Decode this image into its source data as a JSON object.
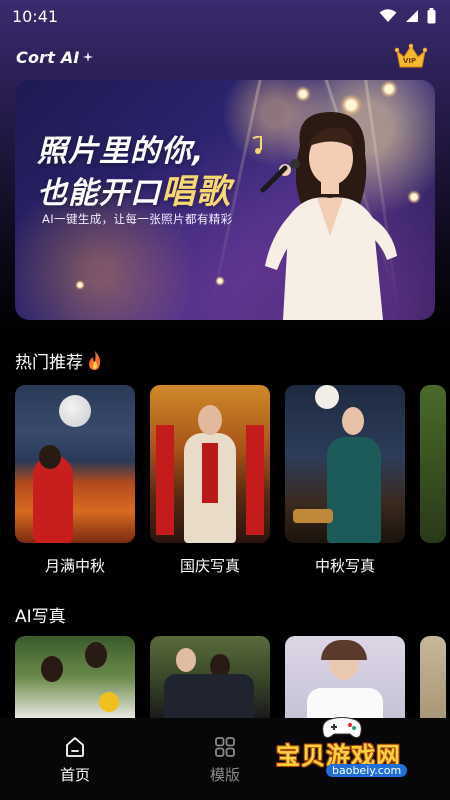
{
  "status_bar": {
    "time": "10:41"
  },
  "header": {
    "logo": "Cort AI",
    "vip_badge": "VIP"
  },
  "banner": {
    "title_line1": "照片里的你,",
    "title_line2_prefix": "也能开口",
    "title_line2_highlight": "唱歌",
    "subtitle": "AI一键生成，让每一张照片都有精彩"
  },
  "hot": {
    "title": "热门推荐",
    "items": [
      {
        "label": "月满中秋"
      },
      {
        "label": "国庆写真"
      },
      {
        "label": "中秋写真"
      }
    ]
  },
  "ai_photo": {
    "title": "AI写真"
  },
  "nav": {
    "items": [
      {
        "label": "首页",
        "icon": "home-icon",
        "active": true
      },
      {
        "label": "模版",
        "icon": "grid-icon",
        "active": false
      }
    ]
  },
  "watermark": {
    "text": "宝贝游戏网",
    "url": "baobeiy.com"
  },
  "colors": {
    "accent_gold": "#f7d774",
    "bg": "#000000",
    "header_purple": "#3a2a6e"
  }
}
